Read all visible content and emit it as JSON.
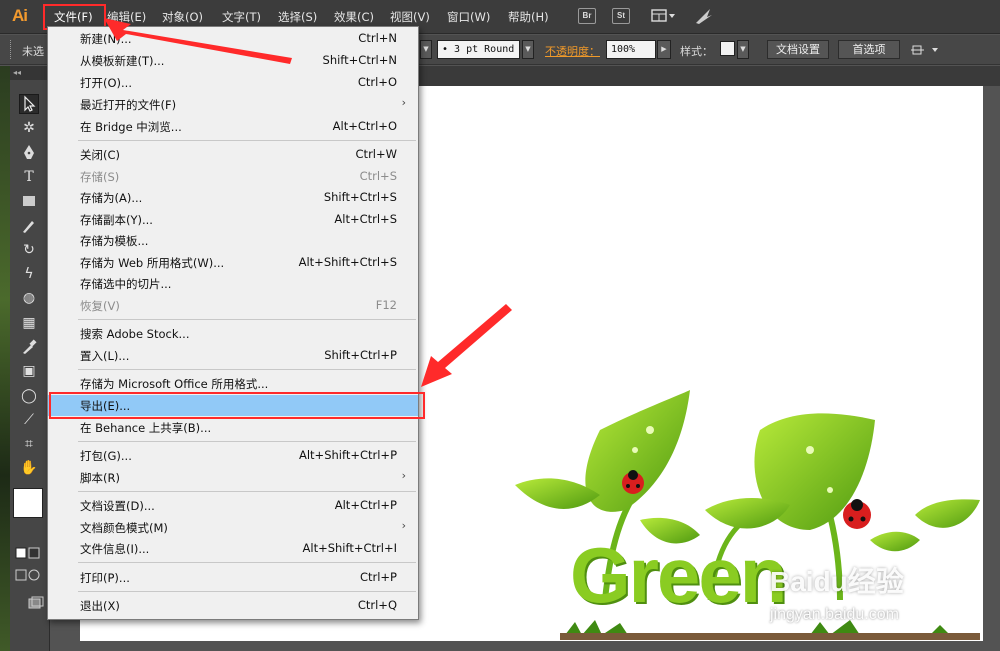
{
  "app": {
    "logo": "Ai"
  },
  "menubar": {
    "items": [
      "文件(F)",
      "编辑(E)",
      "对象(O)",
      "文字(T)",
      "选择(S)",
      "效果(C)",
      "视图(V)",
      "窗口(W)",
      "帮助(H)"
    ],
    "active_item": "文件(F)",
    "buttons": [
      "Br",
      "St"
    ]
  },
  "control_bar": {
    "selection_label": "未选",
    "stroke_profile": "3 pt Round",
    "opacity_label": "不透明度：",
    "opacity_value": "100%",
    "style_label": "样式：",
    "doc_setup_button": "文档设置",
    "preferences_button": "首选项"
  },
  "file_menu": {
    "items": [
      {
        "label": "新建(N)...",
        "shortcut": "Ctrl+N",
        "enabled": true
      },
      {
        "label": "从模板新建(T)...",
        "shortcut": "Shift+Ctrl+N",
        "enabled": true
      },
      {
        "label": "打开(O)...",
        "shortcut": "Ctrl+O",
        "enabled": true
      },
      {
        "label": "最近打开的文件(F)",
        "shortcut": "",
        "submenu": true,
        "enabled": true
      },
      {
        "label": "在 Bridge 中浏览...",
        "shortcut": "Alt+Ctrl+O",
        "enabled": true
      },
      {
        "label": "关闭(C)",
        "shortcut": "Ctrl+W",
        "enabled": true
      },
      {
        "label": "存储(S)",
        "shortcut": "Ctrl+S",
        "enabled": false
      },
      {
        "label": "存储为(A)...",
        "shortcut": "Shift+Ctrl+S",
        "enabled": true
      },
      {
        "label": "存储副本(Y)...",
        "shortcut": "Alt+Ctrl+S",
        "enabled": true
      },
      {
        "label": "存储为模板...",
        "shortcut": "",
        "enabled": true
      },
      {
        "label": "存储为 Web 所用格式(W)...",
        "shortcut": "Alt+Shift+Ctrl+S",
        "enabled": true
      },
      {
        "label": "存储选中的切片...",
        "shortcut": "",
        "enabled": true
      },
      {
        "label": "恢复(V)",
        "shortcut": "F12",
        "enabled": false
      },
      {
        "label": "搜索 Adobe Stock...",
        "shortcut": "",
        "enabled": true
      },
      {
        "label": "置入(L)...",
        "shortcut": "Shift+Ctrl+P",
        "enabled": true
      },
      {
        "label": "存储为 Microsoft Office 所用格式...",
        "shortcut": "",
        "enabled": true
      },
      {
        "label": "导出(E)...",
        "shortcut": "",
        "enabled": true,
        "highlighted": true
      },
      {
        "label": "在 Behance 上共享(B)...",
        "shortcut": "",
        "enabled": true
      },
      {
        "label": "打包(G)...",
        "shortcut": "Alt+Shift+Ctrl+P",
        "enabled": true
      },
      {
        "label": "脚本(R)",
        "shortcut": "",
        "submenu": true,
        "enabled": true
      },
      {
        "label": "文档设置(D)...",
        "shortcut": "Alt+Ctrl+P",
        "enabled": true
      },
      {
        "label": "文档颜色模式(M)",
        "shortcut": "",
        "submenu": true,
        "enabled": true
      },
      {
        "label": "文件信息(I)...",
        "shortcut": "Alt+Shift+Ctrl+I",
        "enabled": true
      },
      {
        "label": "打印(P)...",
        "shortcut": "Ctrl+P",
        "enabled": true
      },
      {
        "label": "退出(X)",
        "shortcut": "Ctrl+Q",
        "enabled": true
      }
    ]
  },
  "artwork": {
    "word": "Green"
  },
  "watermark": {
    "logo": "Baidu经验",
    "url": "jingyan.baidu.com"
  },
  "colors": {
    "menu_highlight": "#91c9f7",
    "annotation_red": "#ff2a2a",
    "app_orange": "#f39a2e",
    "leaf_green": "#7cc21f"
  }
}
